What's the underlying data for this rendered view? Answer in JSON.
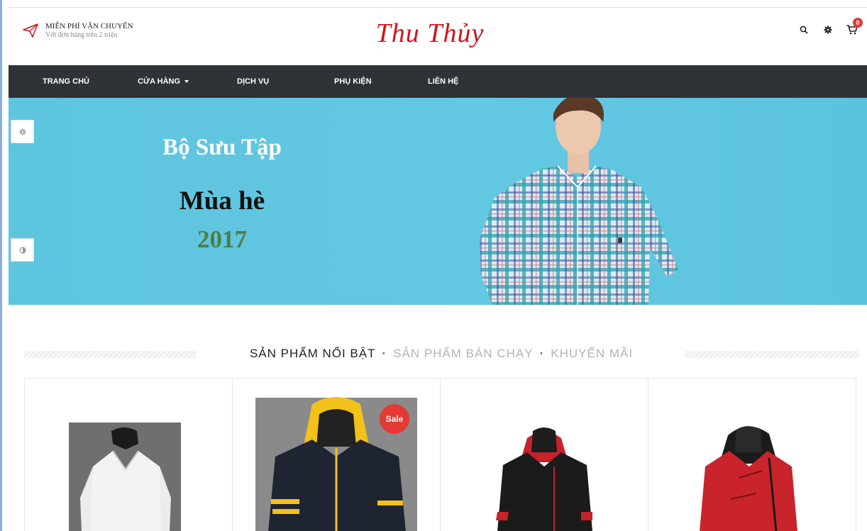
{
  "header": {
    "shipping_title": "MIỄN PHÍ VẬN CHUYỂN",
    "shipping_subtitle": "Với đơn hàng trên 2 triệu",
    "logo": "Thu Thủy",
    "cart_count": "0",
    "icons": [
      "paper-plane-icon",
      "search-icon",
      "gear-icon",
      "cart-icon"
    ]
  },
  "nav": {
    "items": [
      "TRANG CHỦ",
      "CỬA HÀNG",
      "DỊCH VỤ",
      "PHỤ KIỆN",
      "LIÊN HỆ"
    ]
  },
  "banner": {
    "line1": "Bộ Sưu Tập",
    "line2": "Mùa hè",
    "line3": "2017",
    "side_icons": [
      "gear-icon",
      "contrast-icon"
    ]
  },
  "section": {
    "tabs": [
      "SẢN PHẨM NỔI BẬT",
      "SẢN PHẨM BÁN CHẠY",
      "KHUYẾN MÃI"
    ],
    "separator": "·"
  },
  "products": {
    "sale_label": "Sale",
    "items": [
      "white-sweater",
      "black-yellow-hoodie",
      "black-red-hoodie",
      "red-hoodie"
    ]
  },
  "colors": {
    "brand": "#d0131c",
    "nav_bg": "#2f3236",
    "banner_bg": "#5ec5df",
    "sale_badge": "#e53935"
  }
}
